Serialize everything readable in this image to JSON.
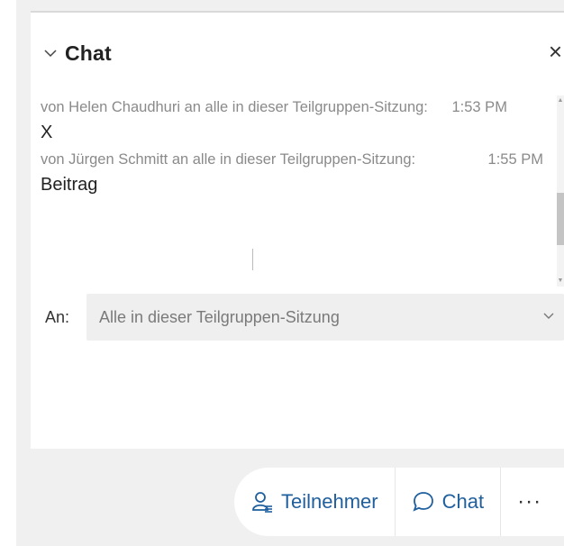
{
  "panel": {
    "title": "Chat",
    "close_symbol": "×"
  },
  "messages": [
    {
      "sender_line": "von Helen Chaudhuri an alle in dieser Teilgruppen-Sitzung:",
      "time": "1:53 PM",
      "text": "X"
    },
    {
      "sender_line": "von Jürgen Schmitt an alle in dieser Teilgruppen-Sitzung:",
      "time": "1:55 PM",
      "text": "Beitrag"
    }
  ],
  "recipient": {
    "label": "An:",
    "value": "Alle in dieser Teilgruppen-Sitzung"
  },
  "toolbar": {
    "participants_label": "Teilnehmer",
    "chat_label": "Chat",
    "more_label": "···"
  },
  "icons": {
    "collapse": "chevron-down-icon",
    "close": "close-icon",
    "dropdown": "chevron-down-icon",
    "participants": "participants-icon",
    "chat": "chat-bubble-icon",
    "more": "more-icon"
  },
  "colors": {
    "accent": "#1f5f9e",
    "meta_text": "#8a8a8a",
    "frame": "#f0f0f0"
  }
}
